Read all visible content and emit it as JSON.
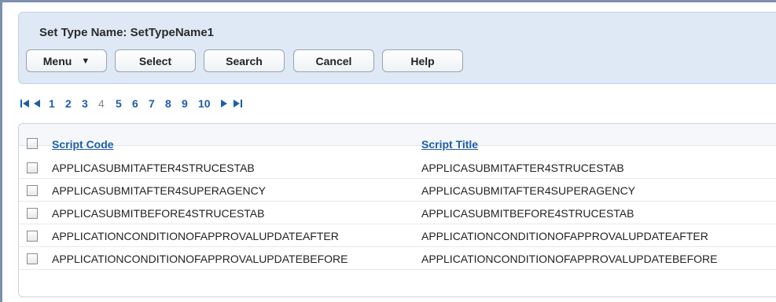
{
  "header": {
    "set_type_label": "Set Type Name: SetTypeName1",
    "buttons": {
      "menu": "Menu",
      "menu_caret": "▼",
      "select": "Select",
      "search": "Search",
      "cancel": "Cancel",
      "help": "Help"
    }
  },
  "pager": {
    "first_icon": "first-page-icon",
    "prev_icon": "previous-page-icon",
    "next_icon": "next-page-icon",
    "last_icon": "last-page-icon",
    "pages": [
      "1",
      "2",
      "3",
      "4",
      "5",
      "6",
      "7",
      "8",
      "9",
      "10"
    ],
    "current_page": "4"
  },
  "table": {
    "columns": [
      "Script Code",
      "Script Title"
    ],
    "rows": [
      [
        "APPLICASUBMITAFTER4STRUCESTAB",
        "APPLICASUBMITAFTER4STRUCESTAB"
      ],
      [
        "APPLICASUBMITAFTER4SUPERAGENCY",
        "APPLICASUBMITAFTER4SUPERAGENCY"
      ],
      [
        "APPLICASUBMITBEFORE4STRUCESTAB",
        "APPLICASUBMITBEFORE4STRUCESTAB"
      ],
      [
        "APPLICATIONCONDITIONOFAPPROVALUPDATEAFTER",
        "APPLICATIONCONDITIONOFAPPROVALUPDATEAFTER"
      ],
      [
        "APPLICATIONCONDITIONOFAPPROVALUPDATEBEFORE",
        "APPLICATIONCONDITIONOFAPPROVALUPDATEBEFORE"
      ]
    ]
  },
  "colors": {
    "panel_bg": "#dfe9f6",
    "link": "#1d5ea8"
  }
}
